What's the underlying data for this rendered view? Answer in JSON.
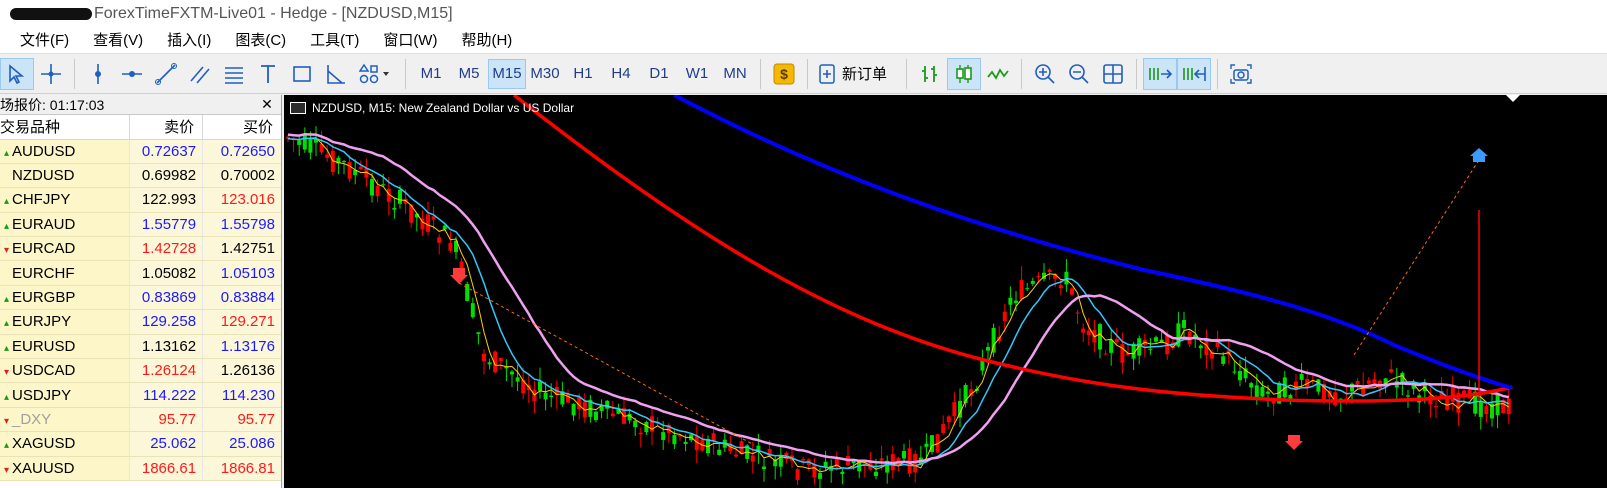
{
  "window": {
    "title": "ForexTimeFXTM-Live01 - Hedge - [NZDUSD,M15]"
  },
  "menu": [
    "文件(F)",
    "查看(V)",
    "插入(I)",
    "图表(C)",
    "工具(T)",
    "窗口(W)",
    "帮助(H)"
  ],
  "toolbar": {
    "timeframes": [
      "M1",
      "M5",
      "M15",
      "M30",
      "H1",
      "H4",
      "D1",
      "W1",
      "MN"
    ],
    "active_timeframe": "M15",
    "new_order_label": "新订单"
  },
  "market_watch": {
    "header": "场报价: 01:17:03",
    "columns": {
      "symbol": "交易品种",
      "bid": "卖价",
      "ask": "买价"
    },
    "rows": [
      {
        "symbol": "AUDUSD",
        "bid": "0.72637",
        "ask": "0.72650",
        "bid_color": "blue",
        "ask_color": "blue",
        "dir": "up"
      },
      {
        "symbol": "NZDUSD",
        "bid": "0.69982",
        "ask": "0.70002",
        "bid_color": "black",
        "ask_color": "black",
        "dir": "none"
      },
      {
        "symbol": "CHFJPY",
        "bid": "122.993",
        "ask": "123.016",
        "bid_color": "black",
        "ask_color": "red",
        "dir": "up"
      },
      {
        "symbol": "EURAUD",
        "bid": "1.55779",
        "ask": "1.55798",
        "bid_color": "blue",
        "ask_color": "blue",
        "dir": "up"
      },
      {
        "symbol": "EURCAD",
        "bid": "1.42728",
        "ask": "1.42751",
        "bid_color": "red",
        "ask_color": "black",
        "dir": "dn"
      },
      {
        "symbol": "EURCHF",
        "bid": "1.05082",
        "ask": "1.05103",
        "bid_color": "black",
        "ask_color": "blue",
        "dir": "none"
      },
      {
        "symbol": "EURGBP",
        "bid": "0.83869",
        "ask": "0.83884",
        "bid_color": "blue",
        "ask_color": "blue",
        "dir": "up"
      },
      {
        "symbol": "EURJPY",
        "bid": "129.258",
        "ask": "129.271",
        "bid_color": "blue",
        "ask_color": "red",
        "dir": "up"
      },
      {
        "symbol": "EURUSD",
        "bid": "1.13162",
        "ask": "1.13176",
        "bid_color": "black",
        "ask_color": "blue",
        "dir": "up"
      },
      {
        "symbol": "USDCAD",
        "bid": "1.26124",
        "ask": "1.26136",
        "bid_color": "red",
        "ask_color": "black",
        "dir": "dn"
      },
      {
        "symbol": "USDJPY",
        "bid": "114.222",
        "ask": "114.230",
        "bid_color": "blue",
        "ask_color": "blue",
        "dir": "up"
      },
      {
        "symbol": "_DXY",
        "bid": "95.77",
        "ask": "95.77",
        "bid_color": "red",
        "ask_color": "red",
        "dir": "dn",
        "grey": true
      },
      {
        "symbol": "XAGUSD",
        "bid": "25.062",
        "ask": "25.086",
        "bid_color": "blue",
        "ask_color": "blue",
        "dir": "up"
      },
      {
        "symbol": "XAUUSD",
        "bid": "1866.61",
        "ask": "1866.81",
        "bid_color": "red",
        "ask_color": "red",
        "dir": "dn"
      }
    ]
  },
  "chart": {
    "title": "NZDUSD, M15:  New Zealand Dollar vs US Dollar",
    "colors": {
      "background": "#000000",
      "bull": "#00e000",
      "bear": "#ff0000",
      "ma_long": "#0000ff",
      "ma_mid": "#ff0000",
      "ma_slow": "#f0a0f0",
      "ma_fast": "#30c8ff",
      "ma_fastest": "#ffd000"
    }
  }
}
